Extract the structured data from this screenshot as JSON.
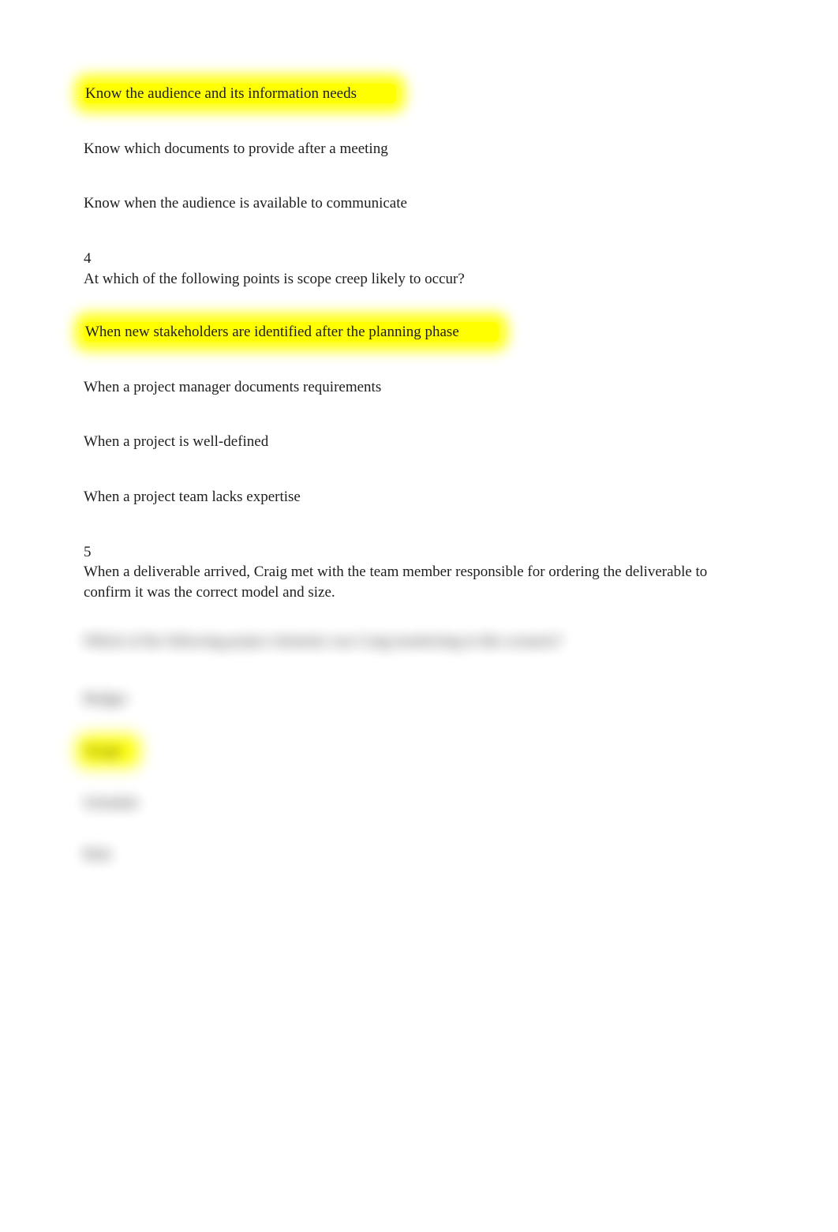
{
  "q3_partial": {
    "answers": [
      {
        "text": "Know the audience and its information needs",
        "hi": true
      },
      {
        "text": "Know which documents to provide after a meeting",
        "hi": false
      },
      {
        "text": "Know when the audience is available to communicate",
        "hi": false
      }
    ]
  },
  "q4": {
    "number": "4",
    "text": "At which of the following points is scope creep likely to occur?",
    "answers": [
      {
        "text": "When new stakeholders are identified after the planning phase",
        "hi": true
      },
      {
        "text": "When a project manager documents requirements",
        "hi": false
      },
      {
        "text": "When a project is well-defined",
        "hi": false
      },
      {
        "text": "When a project team lacks expertise",
        "hi": false
      }
    ]
  },
  "q5": {
    "number": "5",
    "intro": "When a deliverable arrived, Craig met with the team member responsible for ordering the deliverable to confirm it was the correct model and size.",
    "blurred_question": "Which of the following project elements was Craig monitoring in this scenario?",
    "blurred_answers": [
      {
        "text": "Budget",
        "hi": false
      },
      {
        "text": "Scope",
        "hi": true
      },
      {
        "text": "Schedule",
        "hi": false
      },
      {
        "text": "Risk",
        "hi": false
      }
    ]
  }
}
